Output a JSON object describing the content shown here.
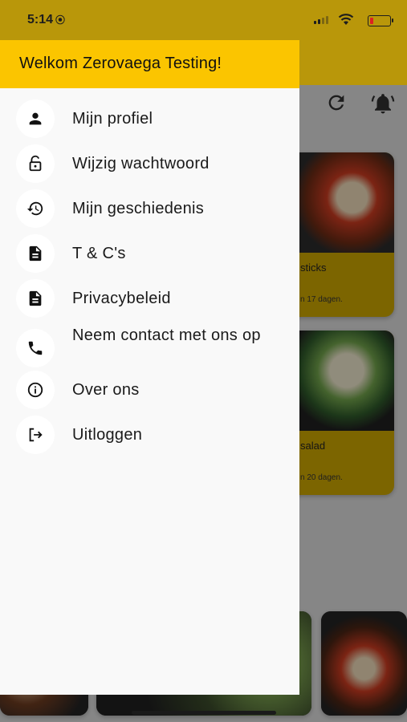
{
  "status_bar": {
    "time": "5:14"
  },
  "drawer": {
    "header_title": "Welkom Zerovaega Testing!",
    "items": [
      {
        "label": "Mijn profiel",
        "icon": "person-icon"
      },
      {
        "label": "Wijzig wachtwoord",
        "icon": "lock-icon"
      },
      {
        "label": "Mijn geschiedenis",
        "icon": "history-icon"
      },
      {
        "label": "T & C's",
        "icon": "document-icon"
      },
      {
        "label": "Privacybeleid",
        "icon": "document-icon"
      },
      {
        "label": "Neem contact met ons op",
        "icon": "phone-icon"
      },
      {
        "label": "Over ons",
        "icon": "info-icon"
      },
      {
        "label": "Uitloggen",
        "icon": "logout-icon"
      }
    ]
  },
  "background_cards": [
    {
      "title": "sticks",
      "subtitle": "n 17 dagen."
    },
    {
      "title": "salad",
      "subtitle": "n 20 dagen."
    }
  ],
  "colors": {
    "accent": "#fbc500",
    "drawer_bg": "#f9f9f9"
  }
}
